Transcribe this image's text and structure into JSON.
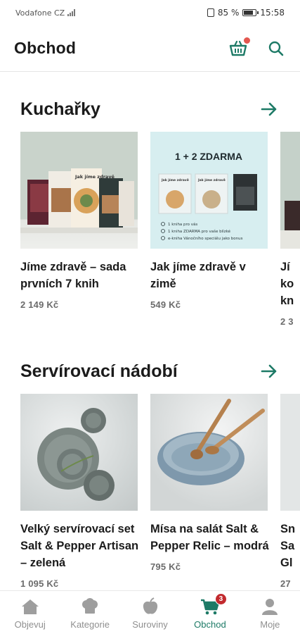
{
  "status_bar": {
    "carrier": "Vodafone CZ",
    "battery": "85 %",
    "time": "15:58"
  },
  "header": {
    "title": "Obchod",
    "cart_icon": "basket-icon",
    "search_icon": "search-icon"
  },
  "sections": [
    {
      "title": "Kuchařky",
      "items": [
        {
          "title": "Jíme zdravě – sada prvních 7 knih",
          "price": "2 149 Kč"
        },
        {
          "title": "Jak jíme zdravě v zimě",
          "price": "549 Kč",
          "promo_text": "1 + 2 ZDARMA"
        },
        {
          "title": "Jí ko kn",
          "price": "2 3"
        }
      ]
    },
    {
      "title": "Servírovací nádobí",
      "items": [
        {
          "title": "Velký servírovací set Salt & Pepper Artisan – zelená",
          "price": "1 095 Kč"
        },
        {
          "title": "Mísa na salát Salt & Pepper Relic – modrá",
          "price": "795 Kč"
        },
        {
          "title": "Sn Sa Gl",
          "price": "27"
        }
      ]
    }
  ],
  "promo_lines": [
    "1 kniha pro vás",
    "1 kniha ZDARMA pro vaše blízké",
    "e-kniha Vánočního speciálu jako bonus"
  ],
  "book_cover_text": "Jak jíme zdravě",
  "bottom_nav": [
    {
      "label": "Objevuj",
      "icon": "home-icon",
      "active": false
    },
    {
      "label": "Kategorie",
      "icon": "chef-hat-icon",
      "active": false
    },
    {
      "label": "Suroviny",
      "icon": "apple-icon",
      "active": false
    },
    {
      "label": "Obchod",
      "icon": "cart-icon",
      "active": true,
      "badge": "3"
    },
    {
      "label": "Moje",
      "icon": "user-icon",
      "active": false
    }
  ],
  "colors": {
    "accent": "#1d7a66",
    "badge": "#c22a2e",
    "notification_dot": "#e3574f",
    "inactive_nav": "#8f8f8f"
  }
}
